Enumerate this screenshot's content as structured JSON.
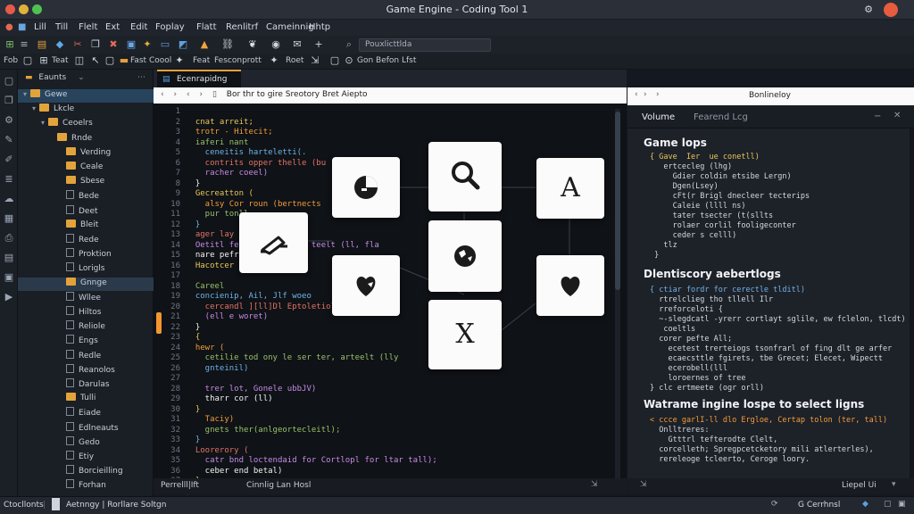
{
  "window": {
    "title": "Game Engine - Coding Tool 1"
  },
  "menu": {
    "items": [
      "Lill",
      "Till",
      "Flelt",
      "Ext",
      "Edit",
      "Foplay",
      "Flatt",
      "Renlitrf",
      "Cameinnig",
      "Hhtp"
    ]
  },
  "toolbar": {
    "search_text": "Pouxlicttlda",
    "row2": [
      "Fob",
      "Teat",
      "Fast Coool",
      "Feat",
      "Fesconprott",
      "Roet",
      "Gon Befon Lfst"
    ]
  },
  "explorer": {
    "title": "Eaunts",
    "items": [
      {
        "label": "Gewe",
        "kind": "folder",
        "depth": 0,
        "state": "selected"
      },
      {
        "label": "Lkcle",
        "kind": "folder",
        "depth": 1
      },
      {
        "label": "Ceoelrs",
        "kind": "folder",
        "depth": 2
      },
      {
        "label": "Rnde",
        "kind": "folder",
        "depth": 3
      },
      {
        "label": "Verding",
        "kind": "folder",
        "depth": 4
      },
      {
        "label": "Ceale",
        "kind": "folder",
        "depth": 4
      },
      {
        "label": "Sbese",
        "kind": "folder",
        "depth": 4
      },
      {
        "label": "Bede",
        "kind": "file",
        "depth": 4
      },
      {
        "label": "Deet",
        "kind": "file",
        "depth": 4
      },
      {
        "label": "Bleit",
        "kind": "folder",
        "depth": 4
      },
      {
        "label": "Rede",
        "kind": "file",
        "depth": 4
      },
      {
        "label": "Proktion",
        "kind": "file",
        "depth": 4
      },
      {
        "label": "Lorigls",
        "kind": "file",
        "depth": 4
      },
      {
        "label": "Gnnge",
        "kind": "folder",
        "depth": 4,
        "state": "highlight"
      },
      {
        "label": "Wllee",
        "kind": "file",
        "depth": 4
      },
      {
        "label": "Hiltos",
        "kind": "file",
        "depth": 4
      },
      {
        "label": "Reliole",
        "kind": "file",
        "depth": 4
      },
      {
        "label": "Engs",
        "kind": "file",
        "depth": 4
      },
      {
        "label": "Redle",
        "kind": "file",
        "depth": 4
      },
      {
        "label": "Reanolos",
        "kind": "file",
        "depth": 4
      },
      {
        "label": "Darulas",
        "kind": "file",
        "depth": 4
      },
      {
        "label": "Tulli",
        "kind": "folder",
        "depth": 4
      },
      {
        "label": "Eiade",
        "kind": "file",
        "depth": 4
      },
      {
        "label": "Edlneauts",
        "kind": "file",
        "depth": 4
      },
      {
        "label": "Gedo",
        "kind": "file",
        "depth": 4
      },
      {
        "label": "Etiy",
        "kind": "file",
        "depth": 4
      },
      {
        "label": "Borcieilling",
        "kind": "file",
        "depth": 4
      },
      {
        "label": "Forhan",
        "kind": "file",
        "depth": 4
      }
    ]
  },
  "editor": {
    "tab_label": "Ecenrapidng",
    "breadcrumb": "Bor thr to gire Sreotory Bret Aiepto",
    "status_left": "Perrelll|Ift",
    "status_mid": "Cinnlig Lan Hosl",
    "lines": [
      {
        "n": "1",
        "t": ""
      },
      {
        "n": "2",
        "t": "  cnat arreit;"
      },
      {
        "n": "3",
        "t": "  trotr - Hitecit;"
      },
      {
        "n": "4",
        "t": "  iaferi nant"
      },
      {
        "n": "5",
        "t": "    ceneitis harteletti(."
      },
      {
        "n": "6",
        "t": "    contrits opper thelle (bu"
      },
      {
        "n": "7",
        "t": "    racher coeel)"
      },
      {
        "n": "8",
        "t": "  }"
      },
      {
        "n": "9",
        "t": "  Gecreatton ("
      },
      {
        "n": "10",
        "t": "    alsy Cor roun (bertnects"
      },
      {
        "n": "11",
        "t": "    pur tonll"
      },
      {
        "n": "12",
        "t": "  }"
      },
      {
        "n": "13",
        "t": "  ager lay"
      },
      {
        "n": "14",
        "t": "  Oetitl feen elerlh gper teelt (ll, fla"
      },
      {
        "n": "15",
        "t": "  nare pefrt"
      },
      {
        "n": "16",
        "t": "  Hacotcer"
      },
      {
        "n": "17",
        "t": ""
      },
      {
        "n": "18",
        "t": "  Careel"
      },
      {
        "n": "19",
        "t": "  concienip, Ail, Jlf woeo "
      },
      {
        "n": "20",
        "t": "    cercandl ][ll]Dl Eptoletiol (lll"
      },
      {
        "n": "21",
        "t": "    (ell e woret)"
      },
      {
        "n": "22",
        "t": "  }"
      },
      {
        "n": "23",
        "t": "  {"
      },
      {
        "n": "24",
        "t": "  hewr ("
      },
      {
        "n": "25",
        "t": "    cetilie tod ony le ser ter, arteelt (lly"
      },
      {
        "n": "26",
        "t": "    gnteinil)"
      },
      {
        "n": "27",
        "t": "  "
      },
      {
        "n": "28",
        "t": "    trer lot, Gonele ubbJV)"
      },
      {
        "n": "29",
        "t": "    tharr cor (ll)"
      },
      {
        "n": "30",
        "t": "  }"
      },
      {
        "n": "31",
        "t": "    Taciy)"
      },
      {
        "n": "32",
        "t": "    gnets ther(anlgeortecleitl);"
      },
      {
        "n": "33",
        "t": "  }"
      },
      {
        "n": "34",
        "t": "  Loorerory ("
      },
      {
        "n": "35",
        "t": "    catr bnd loctendaid for Cortlopl for ltar tall);"
      },
      {
        "n": "36",
        "t": "    ceber end betal)"
      },
      {
        "n": "37",
        "t": "  }"
      },
      {
        "n": "38",
        "t": "}"
      }
    ]
  },
  "cards": {
    "text_a": "A",
    "text_x": "X"
  },
  "right_panel": {
    "header": "Bonlineloy",
    "tab_active": "Volume",
    "tab_other": "Fearend Lcg",
    "sections": [
      {
        "title": "Game lops",
        "lines": [
          "{ Gave  Ier  ue conetll)",
          "   ertcecleg (lhg)",
          "     Gdier coldin etsibe Lergn)",
          "     Dgen(Lsey)",
          "     cFt(r Brigl dnecleer tecterips",
          "     Caleie (llll ns)",
          "     tater tsecter (t(sllts",
          "     rolaer corlil fooligeconter",
          "     ceder s celll)",
          "   tlz",
          " }"
        ]
      },
      {
        "title": "Dlentiscory aebertlogs",
        "lines": [
          "{ ctiar fordr for cerectle tlditl)",
          "  rtrelclieg tho tllell Ilr",
          "  rreforceloti {",
          "  ~-slegdcatl -yrerr cortlayt sglile, ew fclelon, tlcdt)",
          "   coeltls",
          "  corer pefte All;",
          "    ecetest trerteiogs tsonfrarl of fing dlt ge arfer",
          "    ecaecsttle fgirets, tbe Grecet; Elecet, Wipectt",
          "    ecerobell(lll",
          "    loroernes of tree",
          "} clc ertmeete (ogr orll)"
        ]
      },
      {
        "title": "Watrame ingine lospe to select ligns",
        "lines": [
          "< ccce garlI-ll dlo Ergloe, Certap tolon (ter, tall)",
          "  Onlltreres:",
          "    Gtttrl tefterodte Clelt,",
          "  corcelleth; Spregpcetcketory mili atlerterles),",
          "  rereleoge tcleerto, Ceroge loory."
        ]
      }
    ],
    "status_right": "Liepel Ui"
  },
  "statusbar": {
    "left": "Ctocllonts",
    "middle": "Aetnngy | Rorllare Soltgn",
    "right": "G Cerrhnsl"
  }
}
